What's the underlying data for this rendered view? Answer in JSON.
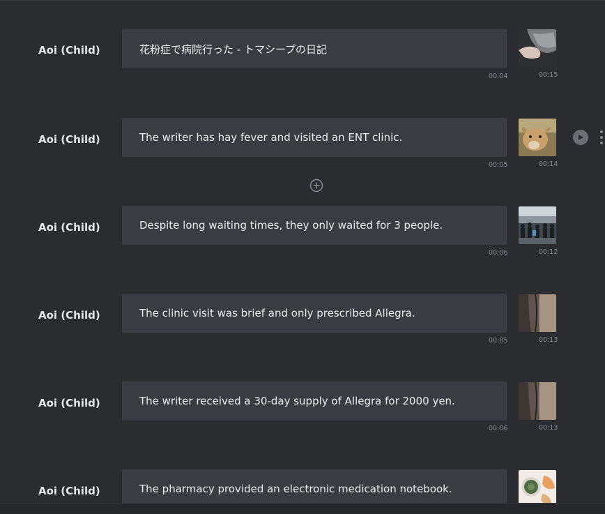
{
  "rows": [
    {
      "speaker": "Aoi (Child)",
      "text": "花粉症で病院行った - トマシープの日記",
      "text_duration": "00:04",
      "media_duration": "00:15",
      "media": "hand-towel-photo"
    },
    {
      "speaker": "Aoi (Child)",
      "text": "The writer has hay fever and visited an ENT clinic.",
      "text_duration": "00:05",
      "media_duration": "00:14",
      "media": "calf-photo"
    },
    {
      "speaker": "Aoi (Child)",
      "text": "Despite long waiting times, they only waited for 3 people.",
      "text_duration": "00:06",
      "media_duration": "00:12",
      "media": "crowd-photo"
    },
    {
      "speaker": "Aoi (Child)",
      "text": "The clinic visit was brief and only prescribed Allegra.",
      "text_duration": "00:05",
      "media_duration": "00:13",
      "media": "curtain-photo"
    },
    {
      "speaker": "Aoi (Child)",
      "text": "The writer received a 30-day supply of Allegra for 2000 yen.",
      "text_duration": "00:06",
      "media_duration": "00:13",
      "media": "curtain-photo"
    },
    {
      "speaker": "Aoi (Child)",
      "text": "The pharmacy provided an electronic medication notebook.",
      "text_duration": "",
      "media_duration": "",
      "media": "herbal-tea-photo"
    }
  ],
  "controls": {
    "play_icon": "play-circle-icon",
    "more_icon": "vertical-ellipsis-icon",
    "add_icon": "plus-circle-icon"
  },
  "colors": {
    "background": "#2b2c30",
    "text_box": "#3b3c41",
    "muted_text": "#8a8b90"
  }
}
